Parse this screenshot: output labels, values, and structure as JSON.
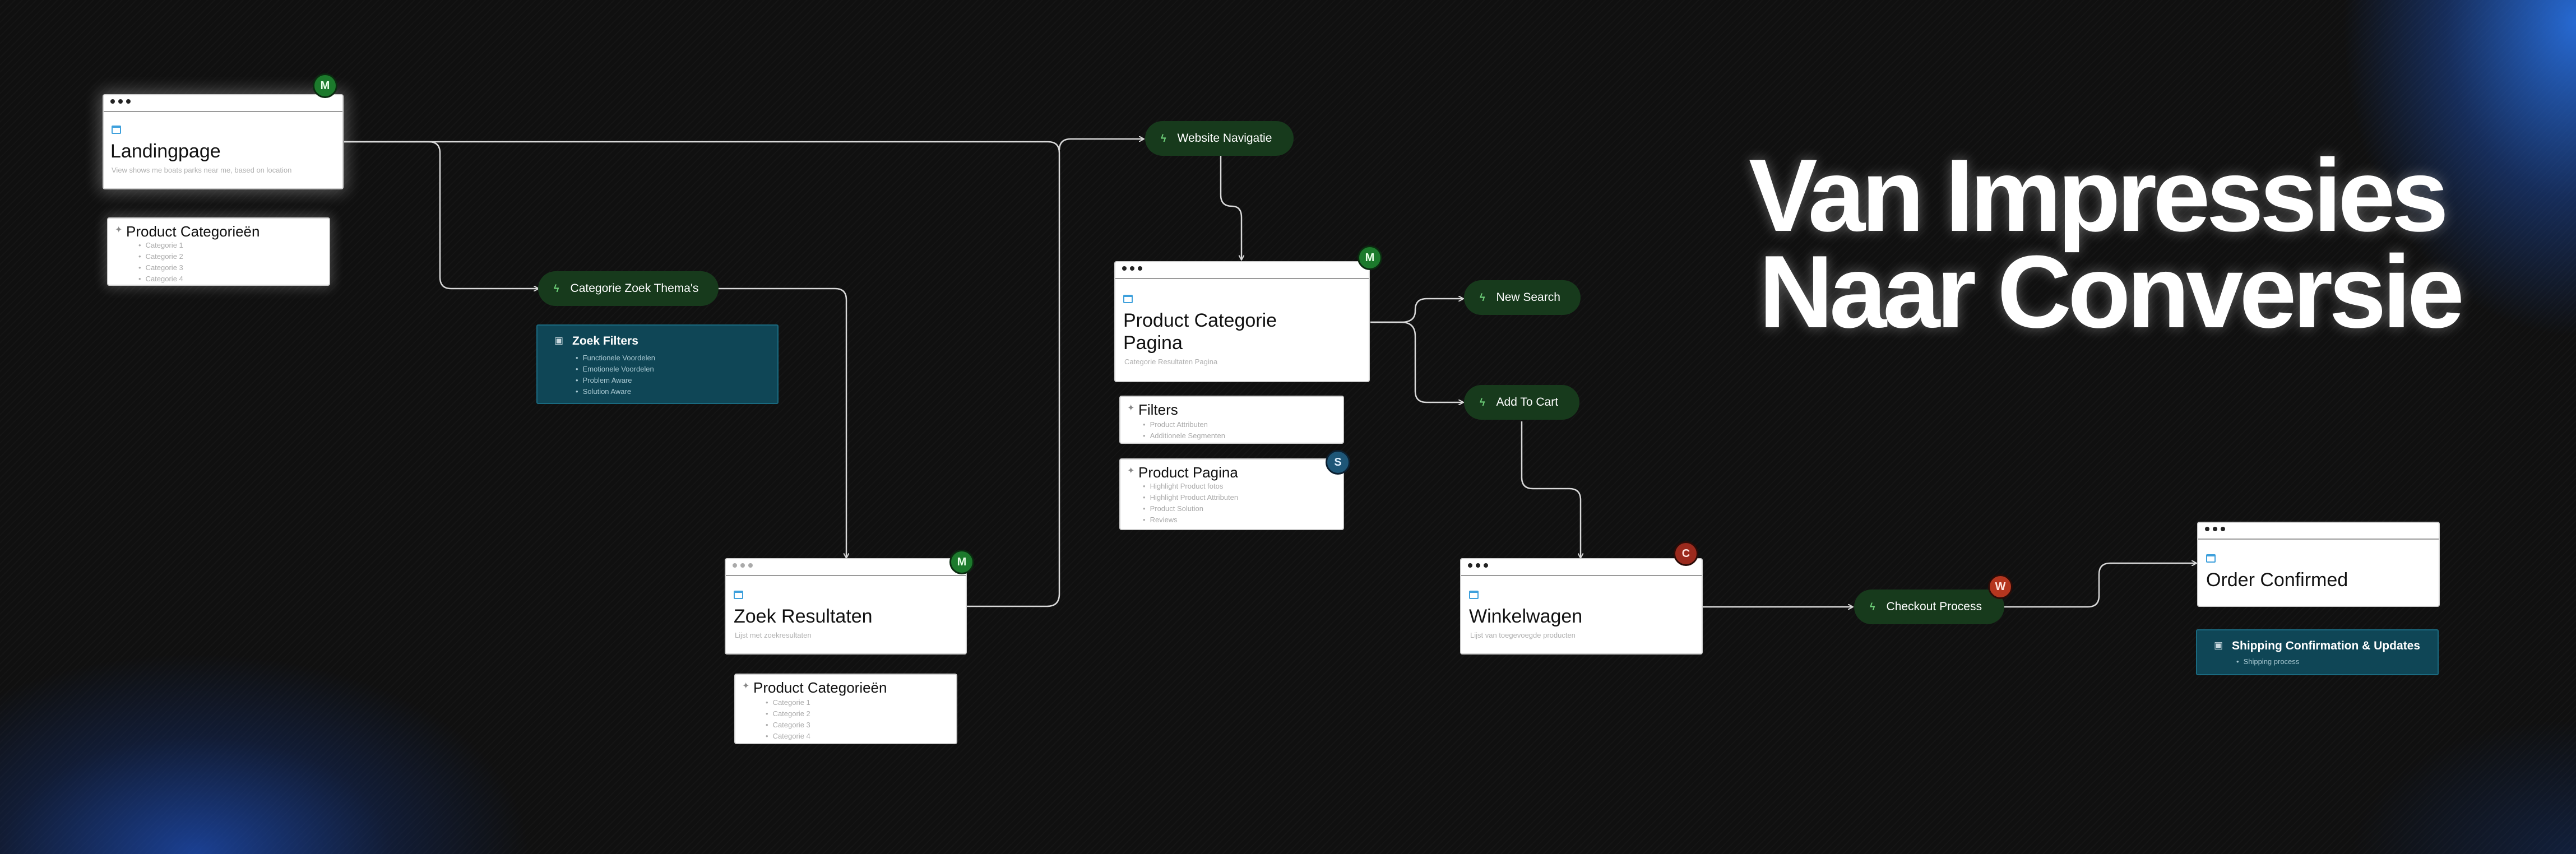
{
  "headline": {
    "line1": "Van Impressies",
    "line2": "Naar Conversie"
  },
  "pages": {
    "landing": {
      "title": "Landingpage",
      "subtitle": "View shows me boats parks near me, based on location",
      "badge": "M"
    },
    "zoek": {
      "title": "Zoek Resultaten",
      "subtitle": "Lijst met zoekresultaten",
      "badge": "M"
    },
    "product_categorie": {
      "title_line1": "Product Categorie",
      "title_line2": "Pagina",
      "subtitle": "Categorie Resultaten Pagina",
      "badge": "M"
    },
    "winkelwagen": {
      "title": "Winkelwagen",
      "subtitle": "Lijst van toegevoegde producten",
      "badge": "C"
    },
    "order": {
      "title": "Order Confirmed"
    }
  },
  "lists": {
    "cat1": {
      "title": "Product Categorieën",
      "items": [
        "Categorie 1",
        "Categorie 2",
        "Categorie 3",
        "Categorie 4"
      ]
    },
    "cat2": {
      "title": "Product Categorieën",
      "items": [
        "Categorie 1",
        "Categorie 2",
        "Categorie 3",
        "Categorie 4"
      ]
    },
    "filters": {
      "title": "Filters",
      "items": [
        "Product Attributen",
        "Additionele Segmenten"
      ]
    },
    "product_pagina": {
      "title": "Product Pagina",
      "badge": "S",
      "items": [
        "Highlight Product fotos",
        "Highlight Product Attributen",
        "Product Solution",
        "Reviews"
      ]
    },
    "zoek_filters": {
      "title": "Zoek Filters",
      "items": [
        "Functionele Voordelen",
        "Emotionele Voordelen",
        "Problem Aware",
        "Solution Aware"
      ]
    },
    "shipping": {
      "title": "Shipping Confirmation & Updates",
      "items": [
        "Shipping process"
      ]
    }
  },
  "pills": {
    "categorie_zoek": "Categorie Zoek Thema's",
    "website_navigatie": "Website Navigatie",
    "new_search": "New Search",
    "add_to_cart": "Add To Cart",
    "checkout": "Checkout Process",
    "checkout_badge": "W"
  },
  "colors": {
    "background": "#101010",
    "pill": "#173a1c",
    "accent_green": "#1c7a2c",
    "teal_box": "#0f4656",
    "glow_blue": "#286edc"
  },
  "icons": {
    "pill": "lightning-icon",
    "page": "calendar-icon",
    "list": "sparkle-icon",
    "teal": "robot-icon"
  }
}
